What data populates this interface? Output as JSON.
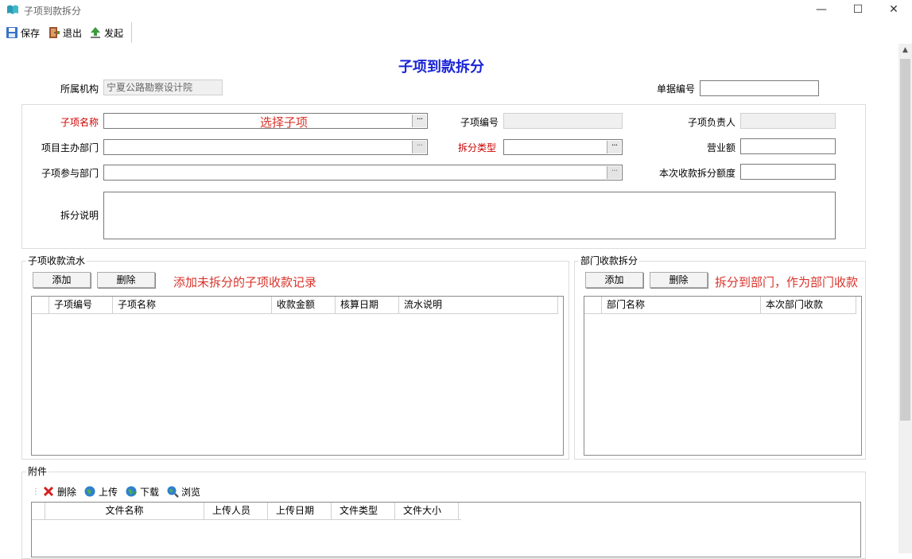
{
  "window": {
    "title": "子项到款拆分",
    "min": "—",
    "max": "☐",
    "close": "✕"
  },
  "toolbar": {
    "save": "保存",
    "exit": "退出",
    "launch": "发起"
  },
  "form": {
    "title": "子项到款拆分",
    "org_label": "所属机构",
    "org_value": "宁夏公路勘察设计院",
    "doc_no_label": "单据编号",
    "sub_name_label": "子项名称",
    "sub_name_hint": "选择子项",
    "sub_no_label": "子项编号",
    "sub_owner_label": "子项负责人",
    "main_dept_label": "项目主办部门",
    "split_type_label": "拆分类型",
    "revenue_label": "营业额",
    "part_dept_label": "子项参与部门",
    "split_amount_label": "本次收款拆分额度",
    "desc_label": "拆分说明"
  },
  "flow": {
    "title": "子项收款流水",
    "add": "添加",
    "delete": "删除",
    "hint": "添加未拆分的子项收款记录",
    "columns": [
      "子项编号",
      "子项名称",
      "收款金额",
      "核算日期",
      "流水说明"
    ]
  },
  "dept": {
    "title": "部门收款拆分",
    "add": "添加",
    "delete": "删除",
    "hint": "拆分到部门，作为部门收款",
    "columns": [
      "部门名称",
      "本次部门收款"
    ]
  },
  "attach": {
    "title": "附件",
    "delete": "删除",
    "upload": "上传",
    "download": "下载",
    "browse": "浏览",
    "columns": [
      "文件名称",
      "上传人员",
      "上传日期",
      "文件类型",
      "文件大小"
    ]
  }
}
